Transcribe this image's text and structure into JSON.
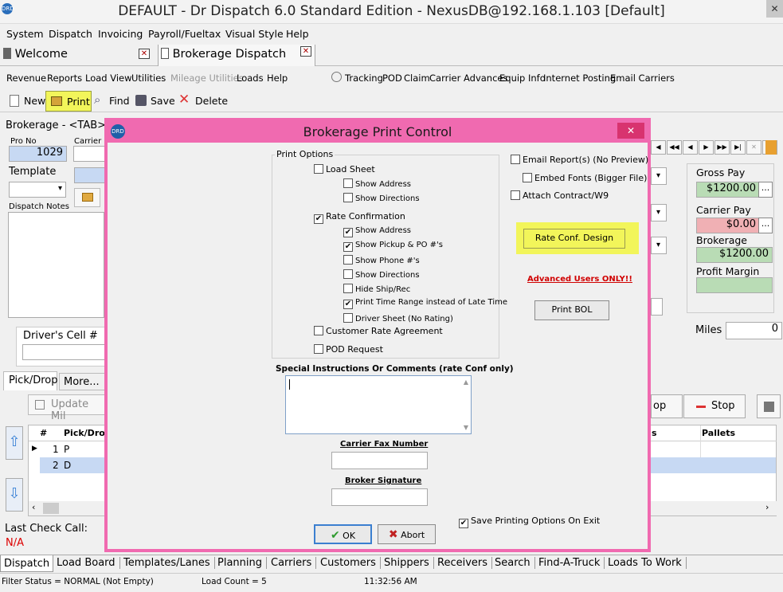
{
  "window": {
    "title": "DEFAULT - Dr Dispatch 6.0 Standard Edition - NexusDB@192.168.1.103 [Default]",
    "close": "✕"
  },
  "menu": [
    "System",
    "Dispatch",
    "Invoicing",
    "Payroll/Fueltax",
    "Visual Style",
    "Help"
  ],
  "tabs": [
    {
      "label": "Welcome"
    },
    {
      "label": "Brokerage Dispatch"
    }
  ],
  "toolbar2": {
    "left": [
      "Revenue",
      "Reports",
      "Load View",
      "Utilities",
      "Mileage Utilities",
      "Loads",
      "Help"
    ],
    "right": [
      "Tracking",
      "POD",
      "Claim",
      "Carrier Advances",
      "Equip Info",
      "Internet Posting",
      "Email Carriers"
    ]
  },
  "toolbar3": {
    "new": "New",
    "print": "Print",
    "find": "Find",
    "save": "Save",
    "delete": "Delete"
  },
  "form": {
    "header": "Brokerage - <TAB>",
    "pro_no_label": "Pro No",
    "pro_no": "1029",
    "carrier_label": "Carrier",
    "template_label": "Template",
    "dispatch_notes_label": "Dispatch Notes",
    "drivers_cell_label": "Driver's Cell #",
    "gross_pay_label": "Gross Pay",
    "gross_pay": "$1200.00",
    "carrier_pay_label": "Carrier Pay",
    "carrier_pay": "$0.00",
    "brokerage_label": "Brokerage",
    "brokerage": "$1200.00",
    "profit_margin_label": "Profit Margin",
    "miles_label": "Miles",
    "miles": "0",
    "ellipsis": "..."
  },
  "picktabs": [
    "Pick/Drop",
    "More..."
  ],
  "update_miles": "Update Mil",
  "stop_button": "Stop",
  "op_button": "op",
  "grid": {
    "headers": [
      "#",
      "Pick/Drop",
      "s",
      "Pallets"
    ],
    "rows": [
      {
        "num": "1",
        "type": "P"
      },
      {
        "num": "2",
        "type": "D"
      }
    ]
  },
  "last_check_call_label": "Last Check Call:",
  "last_check_call": "N/A",
  "dialog": {
    "title": "Brokerage Print Control",
    "close": "✕",
    "print_options_label": "Print Options",
    "load_sheet": "Load Sheet",
    "ls_show_address": "Show Address",
    "ls_show_directions": "Show Directions",
    "rate_confirmation": "Rate Confirmation",
    "rc_show_address": "Show Address",
    "rc_show_pickup": "Show Pickup & PO #'s",
    "rc_show_phone": "Show Phone #'s",
    "rc_show_directions": "Show Directions",
    "rc_hide_ship": "Hide Ship/Rec",
    "rc_print_time": "Print Time Range instead of Late Time",
    "rc_driver_sheet": "Driver Sheet (No Rating)",
    "customer_rate": "Customer Rate Agreement",
    "pod_request": "POD Request",
    "email_reports": "Email Report(s) (No Preview)",
    "embed_fonts": "Embed Fonts (Bigger File)",
    "attach_contract": "Attach Contract/W9",
    "rate_conf_design": "Rate Conf. Design",
    "advanced_users": "Advanced Users ONLY!!",
    "print_bol": "Print BOL",
    "special_instructions": "Special Instructions Or Comments (rate Conf only)",
    "carrier_fax": "Carrier Fax Number",
    "broker_signature": "Broker Signature",
    "save_options": "Save Printing Options On Exit",
    "ok": "OK",
    "abort": "Abort"
  },
  "bottom_tabs": [
    "Dispatch",
    "Load Board",
    "Templates/Lanes",
    "Planning",
    "Carriers",
    "Customers",
    "Shippers",
    "Receivers",
    "Search",
    "Find-A-Truck",
    "Loads To Work"
  ],
  "status": {
    "filter": "Filter Status = NORMAL (Not Empty)",
    "load_count": "Load Count = 5",
    "time": "11:32:56 AM"
  },
  "colors": {
    "dialog_border": "#f06ab0",
    "highlight": "#f2f55a",
    "gross_pay_bg": "#b9dcb5",
    "carrier_pay_bg": "#f0b0b4",
    "field_blue": "#c7d9f3"
  }
}
